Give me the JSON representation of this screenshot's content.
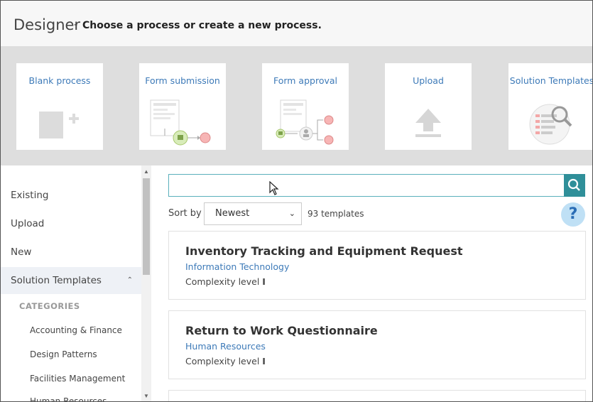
{
  "header": {
    "title": "Designer",
    "separator": "-",
    "subtitle": "Choose a process or create a new process."
  },
  "cards": [
    {
      "label": "Blank process",
      "icon": "blank-process-icon"
    },
    {
      "label": "Form submission",
      "icon": "form-submission-icon"
    },
    {
      "label": "Form approval",
      "icon": "form-approval-icon"
    },
    {
      "label": "Upload",
      "icon": "upload-icon"
    },
    {
      "label": "Solution Templates",
      "icon": "solution-templates-icon"
    }
  ],
  "sidebar": {
    "items": [
      {
        "label": "Existing"
      },
      {
        "label": "Upload"
      },
      {
        "label": "New"
      },
      {
        "label": "Solution Templates",
        "expanded": true
      }
    ],
    "categories_label": "CATEGORIES",
    "categories": [
      "Accounting & Finance",
      "Design Patterns",
      "Facilities Management",
      "Human Resources"
    ]
  },
  "search": {
    "value": "",
    "placeholder": ""
  },
  "sort": {
    "label": "Sort by",
    "selected": "Newest",
    "count": "93 templates"
  },
  "help": {
    "label": "?"
  },
  "templates": [
    {
      "title": "Inventory Tracking and Equipment Request",
      "category": "Information Technology",
      "complexity_label": "Complexity level",
      "complexity_value": "I"
    },
    {
      "title": "Return to Work Questionnaire",
      "category": "Human Resources",
      "complexity_label": "Complexity level",
      "complexity_value": "I"
    }
  ],
  "colors": {
    "accent": "#2f8f99",
    "link": "#3d7ab8",
    "card_bg": "#dedede"
  }
}
